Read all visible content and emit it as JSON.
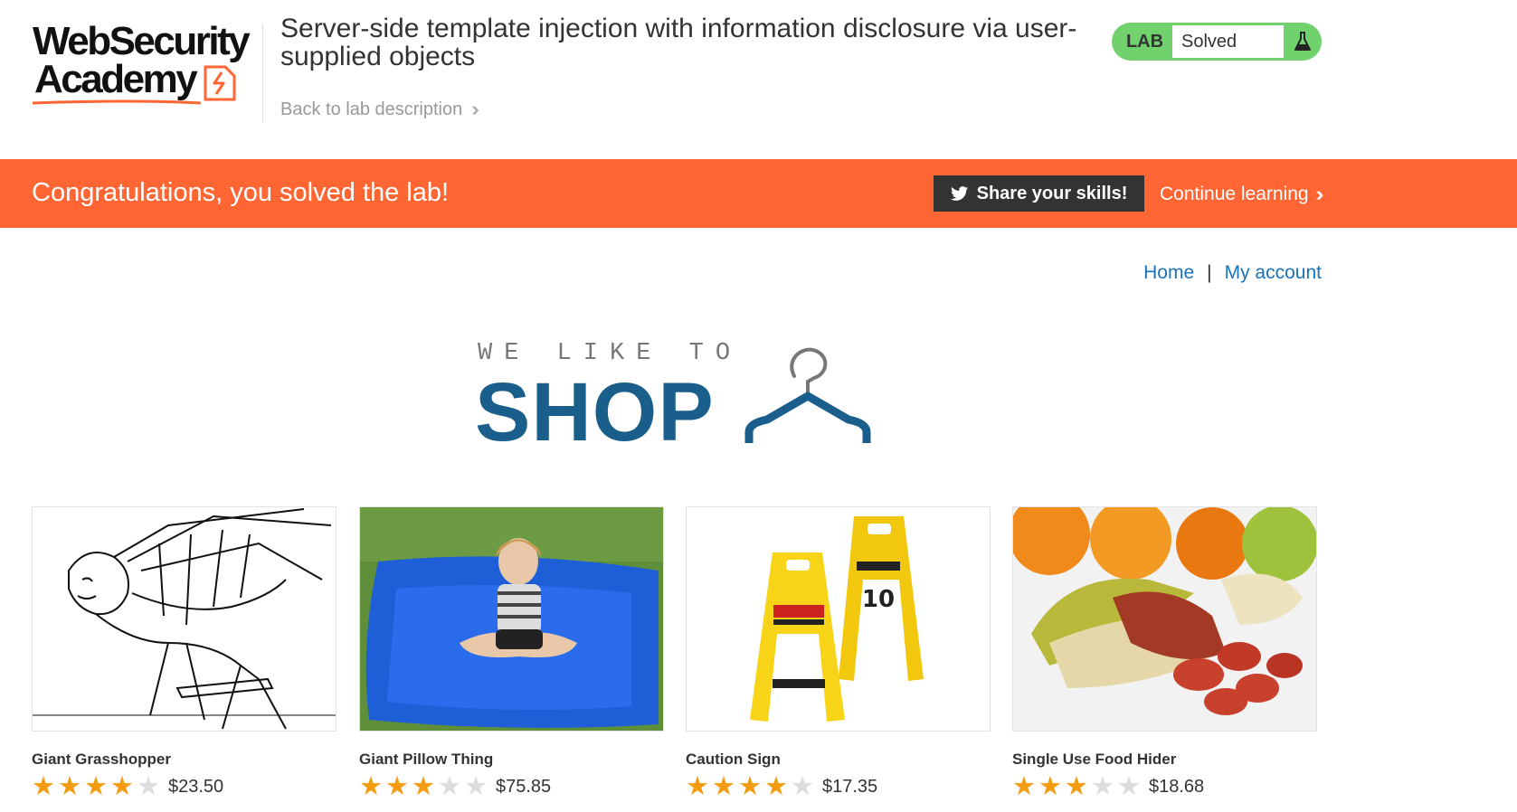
{
  "header": {
    "logo_line1": "WebSecurity",
    "logo_line2": "Academy",
    "lab_title": "Server-side template injection with information disclosure via user-supplied objects",
    "back_link": "Back to lab description",
    "lab_status_label": "LAB",
    "lab_status_value": "Solved",
    "status_color": "#70d16d"
  },
  "banner": {
    "message": "Congratulations, you solved the lab!",
    "share_button": "Share your skills!",
    "share_icon": "twitter-icon",
    "continue_link": "Continue learning",
    "color": "#ff6633"
  },
  "nav": {
    "home": "Home",
    "separator": "|",
    "account": "My account"
  },
  "shop_logo": {
    "small_text": "WE LIKE TO",
    "big_text": "SHOP",
    "icon": "hanger-icon"
  },
  "products": [
    {
      "name": "Giant Grasshopper",
      "price": "$23.50",
      "rating": 4
    },
    {
      "name": "Giant Pillow Thing",
      "price": "$75.85",
      "rating": 3
    },
    {
      "name": "Caution Sign",
      "price": "$17.35",
      "rating": 4
    },
    {
      "name": "Single Use Food Hider",
      "price": "$18.68",
      "rating": 3
    }
  ],
  "rating_max": 5
}
